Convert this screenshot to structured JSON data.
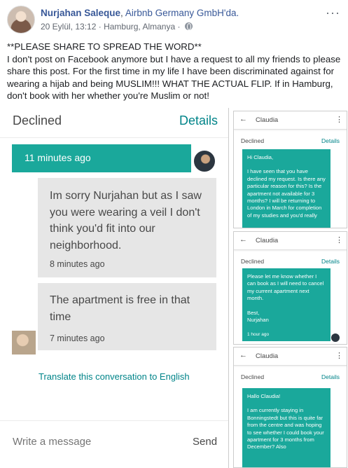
{
  "post": {
    "author": "Nurjahan Saleque",
    "separator": ",",
    "page": "Airbnb Germany GmbH'da.",
    "timestamp": "20 Eylül, 13:12",
    "dot": "·",
    "location": "Hamburg, Almanya",
    "dot2": "·",
    "more_icon": "···",
    "text_lines": [
      "**PLEASE SHARE TO SPREAD THE WORD**",
      "I don't post on Facebook anymore but I have a request to all my friends to please share this post. For the first time in my life I have been discriminated against for wearing a hijab and being MUSLIM!!! WHAT THE ACTUAL FLIP. If in Hamburg, don't book with her whether you're Muslim or not!"
    ]
  },
  "main_screenshot": {
    "status": "Declined",
    "details": "Details",
    "sent_time": "11 minutes ago",
    "messages": [
      {
        "text": "Im sorry Nurjahan but as I saw you were wearing a veil I don't think you'd fit into our neighborhood.",
        "time": "8 minutes ago"
      },
      {
        "text": "The apartment is free in that time",
        "time": "7 minutes ago"
      }
    ],
    "translate": "Translate this conversation to English",
    "input_placeholder": "Write a message",
    "send": "Send"
  },
  "phones": [
    {
      "back": "←",
      "name": "Claudia",
      "menu": "⋮",
      "status": "Declined",
      "details": "Details",
      "paragraphs": [
        "Hi Claudia,",
        "I have seen that you have declined my request. Is there any particular reason for this? Is the apartment not available for 3 months? I will be returning to London in March for completion of my studies and you'd really"
      ]
    },
    {
      "back": "←",
      "name": "Claudia",
      "menu": "⋮",
      "status": "Declined",
      "details": "Details",
      "paragraphs": [
        "Please let me know whether I can book as I will need to cancel my current apartment next month.",
        "Best,\nNurjahan"
      ],
      "time": "1 hour ago"
    },
    {
      "back": "←",
      "name": "Claudia",
      "menu": "⋮",
      "status": "Declined",
      "details": "Details",
      "paragraphs": [
        "Hallo Claudia!",
        "I am currently staying in Bonningstedt but this is quite far from the centre and was hoping to see whether I could book your apartment for 3 months from December? Also"
      ]
    }
  ],
  "colors": {
    "facebook_link": "#385898",
    "airbnb_teal": "#1aa89b",
    "details_teal": "#008489",
    "received_bubble": "#e6e6e6"
  }
}
